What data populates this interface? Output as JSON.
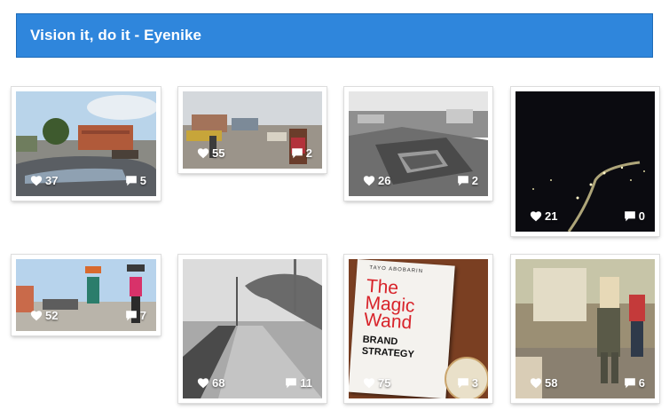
{
  "header": {
    "title": "Vision it, do it - Eyenike"
  },
  "posts": [
    {
      "likes": "37",
      "comments": "5"
    },
    {
      "likes": "55",
      "comments": "2"
    },
    {
      "likes": "26",
      "comments": "2"
    },
    {
      "likes": "21",
      "comments": "0"
    },
    {
      "likes": "52",
      "comments": "7"
    },
    {
      "likes": "68",
      "comments": "11"
    },
    {
      "likes": "75",
      "comments": "3"
    },
    {
      "likes": "58",
      "comments": "6"
    }
  ],
  "book": {
    "author": "TAYO ABOBARIN",
    "title_line1": "The",
    "title_line2": "Magic",
    "title_line3": "Wand",
    "subtitle_line1": "BRAND",
    "subtitle_line2": "STRATEGY"
  },
  "colors": {
    "header_bg": "#2f86dc",
    "book_red": "#d8232a"
  },
  "icons": {
    "like": "heart-icon",
    "comment": "comment-icon"
  }
}
